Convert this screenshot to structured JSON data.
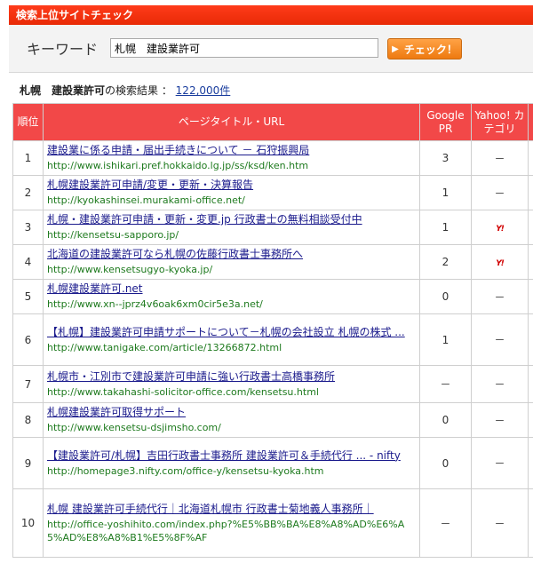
{
  "header": {
    "title": "検索上位サイトチェック"
  },
  "search": {
    "label": "キーワード",
    "value": "札幌　建設業許可",
    "button_label": "チェック！"
  },
  "summary": {
    "keyword": "札幌　建設業許可",
    "suffix": "の検索結果 ：",
    "count": "122,000件"
  },
  "table": {
    "headers": {
      "rank": "順位",
      "title": "ページタイトル・URL",
      "pr": "Google PR",
      "category": "Yahoo! カテゴリ"
    },
    "rows": [
      {
        "rank": "1",
        "title": "建設業に係る申請・届出手続きについて － 石狩振興局",
        "url": "http://www.ishikari.pref.hokkaido.lg.jp/ss/ksd/ken.htm",
        "pr": "3",
        "category": "－",
        "yahoo": false
      },
      {
        "rank": "2",
        "title": "札幌建設業許可申請/変更・更新・決算報告",
        "url": "http://kyokashinsei.murakami-office.net/",
        "pr": "1",
        "category": "－",
        "yahoo": false
      },
      {
        "rank": "3",
        "title": "札幌・建設業許可申請・更新・変更.jp 行政書士の無料相談受付中",
        "url": "http://kensetsu-sapporo.jp/",
        "pr": "1",
        "category": "Y!",
        "yahoo": true
      },
      {
        "rank": "4",
        "title": "北海道の建設業許可なら札幌の佐藤行政書士事務所へ",
        "url": "http://www.kensetsugyo-kyoka.jp/",
        "pr": "2",
        "category": "Y!",
        "yahoo": true
      },
      {
        "rank": "5",
        "title": "札幌建設業許可.net",
        "url": "http://www.xn--jprz4v6oak6xm0cir5e3a.net/",
        "pr": "0",
        "category": "－",
        "yahoo": false
      },
      {
        "rank": "6",
        "title": "【札幌】建設業許可申請サポートについて－札幌の会社設立 札幌の株式 ...",
        "url": "http://www.tanigake.com/article/13266872.html",
        "pr": "1",
        "category": "－",
        "yahoo": false
      },
      {
        "rank": "7",
        "title": "札幌市・江別市で建設業許可申請に強い行政書士高橋事務所",
        "url": "http://www.takahashi-solicitor-office.com/kensetsu.html",
        "pr": "－",
        "category": "－",
        "yahoo": false
      },
      {
        "rank": "8",
        "title": "札幌建設業許可取得サポート",
        "url": "http://www.kensetsu-dsjimsho.com/",
        "pr": "0",
        "category": "－",
        "yahoo": false
      },
      {
        "rank": "9",
        "title": "【建設業許可/札幌】吉田行政書士事務所 建設業許可＆手続代行 ... - nifty",
        "url": "http://homepage3.nifty.com/office-y/kensetsu-kyoka.htm",
        "pr": "0",
        "category": "－",
        "yahoo": false
      },
      {
        "rank": "10",
        "title": "札幌 建設業許可手続代行｜北海道札幌市 行政書士菊地義人事務所｜",
        "url": "http://office-yoshihito.com/index.php?%E5%BB%BA%E8%A8%AD%E6%A5%AD%E8%A8%B1%E5%8F%AF",
        "pr": "－",
        "category": "－",
        "yahoo": false
      }
    ]
  },
  "colors": {
    "titlebar": "#e82a06",
    "header_row": "#f24848",
    "link": "#1a1a8c",
    "url": "#1e7a1e",
    "button": "#ee7a10"
  }
}
